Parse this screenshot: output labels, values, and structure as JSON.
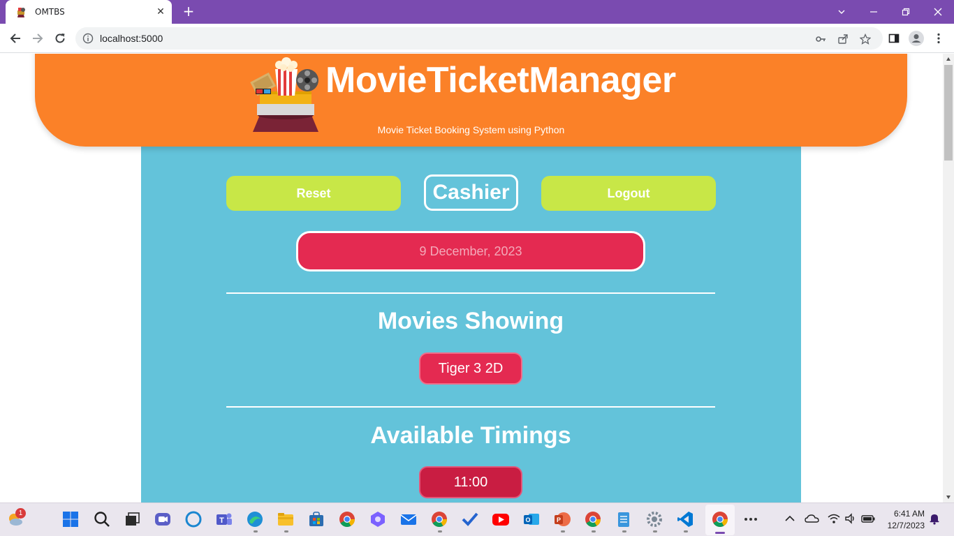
{
  "browser": {
    "tab_title": "OMTBS",
    "url": "localhost:5000"
  },
  "header": {
    "brand": "MovieTicketManager",
    "tagline": "Movie Ticket Booking System using Python"
  },
  "controls": {
    "reset_label": "Reset",
    "role_label": "Cashier",
    "logout_label": "Logout",
    "date_text": "9 December, 2023"
  },
  "movies": {
    "title": "Movies Showing",
    "items": [
      "Tiger 3 2D"
    ]
  },
  "timings": {
    "title": "Available Timings",
    "items": [
      "11:00"
    ]
  },
  "taskbar": {
    "notification_badge": "1",
    "time": "6:41 AM",
    "date": "12/7/2023",
    "icons": [
      "weather-icon",
      "start-icon",
      "search-icon",
      "task-view-icon",
      "meet-icon",
      "cortana-icon",
      "teams-icon",
      "edge-icon",
      "file-explorer-icon",
      "store-icon",
      "chrome-icon",
      "copilot-icon",
      "mail-icon",
      "chrome-profile-icon",
      "todo-icon",
      "youtube-icon",
      "outlook-icon",
      "powerpoint-icon",
      "chrome-c-icon",
      "notepad-icon",
      "settings-icon",
      "vscode-icon",
      "chrome-active-icon",
      "more-icon"
    ]
  },
  "colors": {
    "chrome_titlebar": "#7a4bb0",
    "header_orange": "#fb8128",
    "panel_blue": "#63c3da",
    "button_lime": "#c8e747",
    "accent_red": "#e42a51"
  }
}
